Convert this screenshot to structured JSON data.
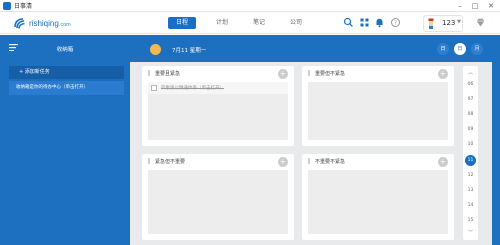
{
  "window": {
    "title": "日事清",
    "minimize": "–",
    "maximize": "□",
    "close": "✕"
  },
  "nav": {
    "logo_text": "rishiqing",
    "logo_suffix": ".com",
    "tabs": [
      {
        "label": "日程",
        "active": true
      },
      {
        "label": "计划",
        "active": false
      },
      {
        "label": "笔记",
        "active": false
      },
      {
        "label": "公司",
        "active": false
      }
    ],
    "icons": [
      "search-icon",
      "grid-icon",
      "bell-icon",
      "help-icon"
    ],
    "user": {
      "name": "123",
      "caret": "▼"
    },
    "diamond_icon": "diamond-icon"
  },
  "sidebar": {
    "title": "收纳箱",
    "add_task": "+ 添加新任务",
    "items": [
      {
        "label": "收纳箱是你的待办中心（单击打开）"
      }
    ]
  },
  "header": {
    "date": "7月11 星期一",
    "views": [
      {
        "label": "日",
        "active": false
      },
      {
        "label": "日",
        "active": true
      },
      {
        "label": "月",
        "active": false
      }
    ]
  },
  "quadrants": [
    {
      "title": "重要且紧急",
      "plus": "+",
      "tasks": [
        {
          "text": "四象限以精通体系（单击打开）",
          "done": true
        }
      ]
    },
    {
      "title": "重要但不紧急",
      "plus": "+",
      "tasks": []
    },
    {
      "title": "紧急但不重要",
      "plus": "+",
      "tasks": []
    },
    {
      "title": "不重要不紧急",
      "plus": "+",
      "tasks": []
    }
  ],
  "hours": {
    "up": "︿",
    "down": "﹀",
    "list": [
      "06",
      "07",
      "08",
      "09",
      "10",
      "11",
      "12",
      "13",
      "14",
      "15"
    ],
    "active": "11"
  },
  "colors": {
    "accent": "#1d6fc0",
    "sun": "#f2b950",
    "background": "#e9eaec"
  }
}
